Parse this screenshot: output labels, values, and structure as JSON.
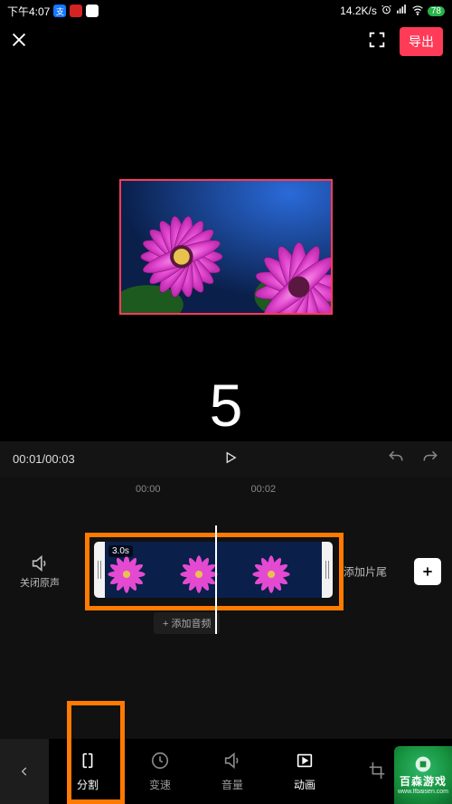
{
  "status": {
    "time": "下午4:07",
    "net_speed": "14.2K/s",
    "battery": "78"
  },
  "topbar": {
    "export_label": "导出"
  },
  "preview": {
    "countdown": "5"
  },
  "playback": {
    "current_time": "00:01",
    "total_time": "00:03"
  },
  "ruler": {
    "tick0": "00:00",
    "tick1": "00:02"
  },
  "timeline": {
    "mute_label": "关闭原声",
    "clip_duration": "3.0s",
    "add_tail_label": "添加片尾",
    "add_audio_label": "+ 添加音频"
  },
  "toolbar": {
    "items": [
      {
        "label": "分割"
      },
      {
        "label": "变速"
      },
      {
        "label": "音量"
      },
      {
        "label": "动画"
      }
    ]
  },
  "watermark": {
    "brand": "百森游戏",
    "url": "www.lfbaisen.com"
  },
  "colors": {
    "accent": "#ff3b57",
    "highlight": "#ff7a00"
  }
}
